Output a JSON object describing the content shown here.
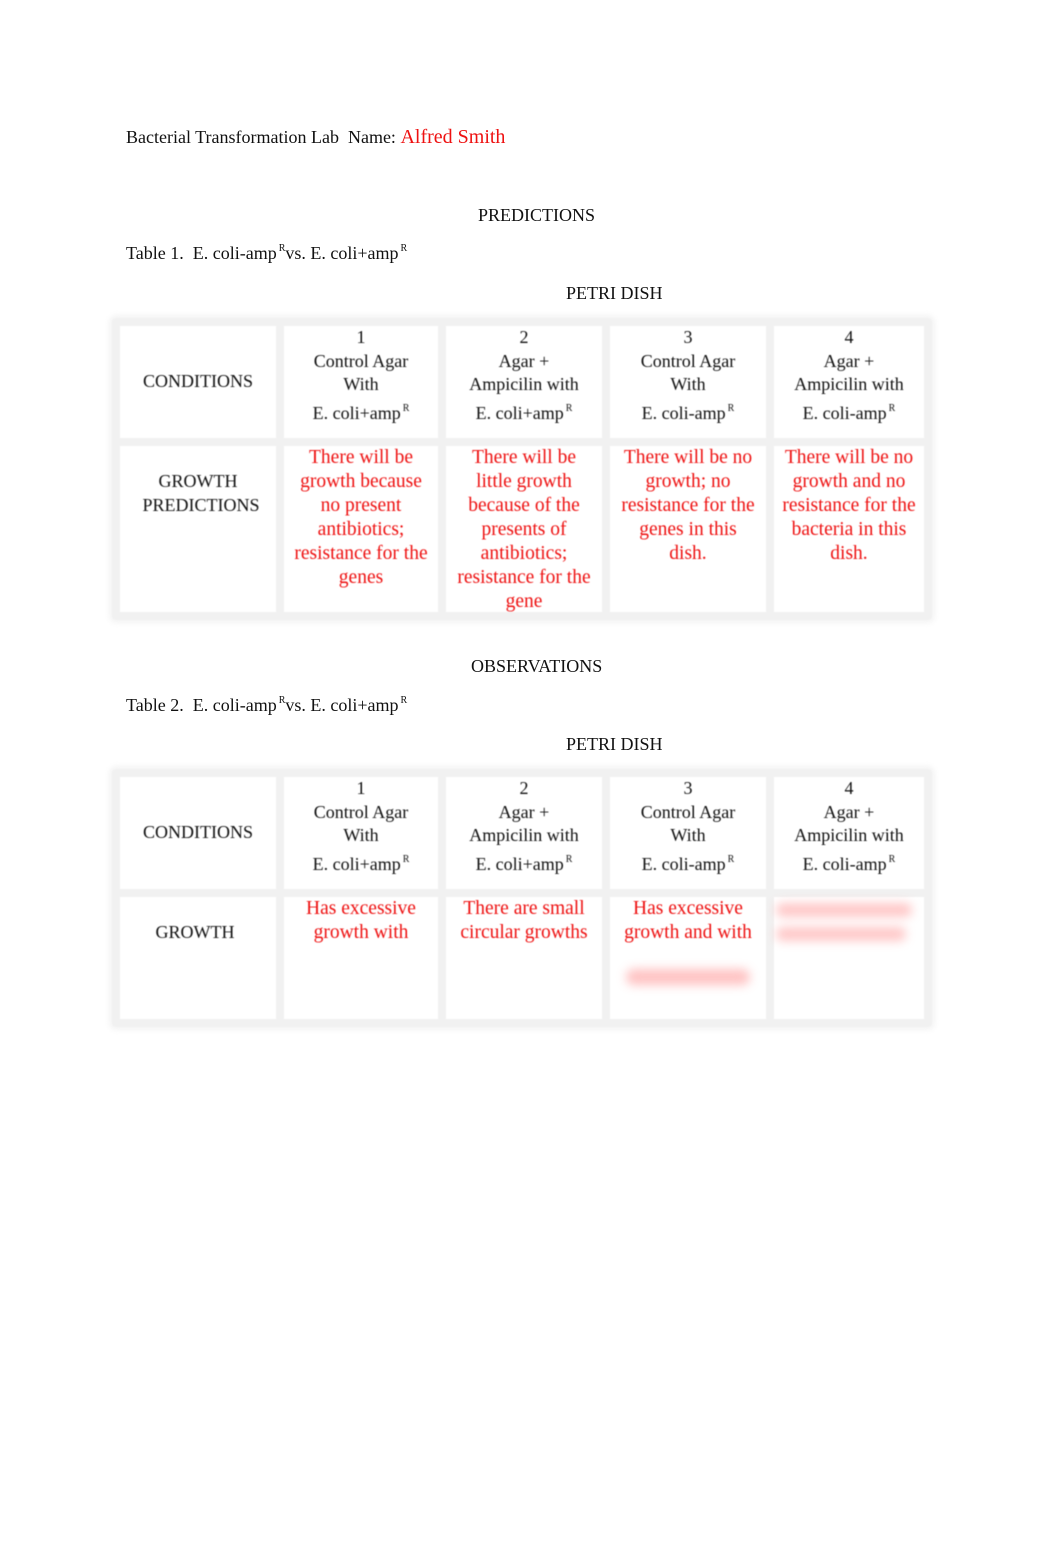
{
  "document": {
    "title_prefix": "Bacterial Transformation Lab  Name: ",
    "student_name": "Alfred Smith",
    "colors": {
      "text": "#111111",
      "answer": "#ee1111"
    }
  },
  "predictions": {
    "heading": "PREDICTIONS",
    "table_caption": {
      "prefix": "Table 1.  E. coli-amp",
      "sup1": "R",
      "middle": "vs. E. coli+amp",
      "sup2": "R"
    },
    "petri_heading": "PETRI DISH",
    "row_labels": {
      "conditions": "CONDITIONS",
      "growth": [
        "GROWTH",
        "PREDICTIONS"
      ]
    },
    "dishes": [
      {
        "number": "1",
        "lines": [
          "Control Agar",
          "With"
        ],
        "strain": "E. coli+amp",
        "sup": "R",
        "answer": [
          "There will be",
          "growth because",
          "no present",
          "antibiotics;",
          "resistance for the",
          "genes"
        ]
      },
      {
        "number": "2",
        "lines": [
          "Agar +",
          "Ampicilin with"
        ],
        "strain": "E. coli+amp",
        "sup": "R",
        "answer": [
          "There will be",
          "little growth",
          "because of the",
          "presents of",
          "antibiotics;",
          "resistance for the",
          "gene"
        ]
      },
      {
        "number": "3",
        "lines": [
          "Control Agar",
          "With"
        ],
        "strain": "E. coli-amp",
        "sup": "R",
        "answer": [
          "There will be no",
          "growth; no",
          "resistance for the",
          "genes in this",
          "dish."
        ]
      },
      {
        "number": "4",
        "lines": [
          "Agar +",
          "Ampicilin with"
        ],
        "strain": "E. coli-amp",
        "sup": "R",
        "answer": [
          "There will be no",
          "growth and no",
          "resistance for the",
          "bacteria in this",
          "dish."
        ]
      }
    ]
  },
  "observations": {
    "heading": "OBSERVATIONS",
    "table_caption": {
      "prefix": "Table 2.  E. coli-amp",
      "sup1": "R",
      "middle": "vs. E. coli+amp",
      "sup2": "R"
    },
    "petri_heading": "PETRI DISH",
    "row_labels": {
      "conditions": "CONDITIONS",
      "growth": "GROWTH"
    },
    "dishes": [
      {
        "number": "1",
        "lines": [
          "Control Agar",
          "With"
        ],
        "strain": "E. coli+amp",
        "sup": "R",
        "answer": [
          "Has excessive",
          "growth with"
        ]
      },
      {
        "number": "2",
        "lines": [
          "Agar +",
          "Ampicilin with"
        ],
        "strain": "E. coli+amp",
        "sup": "R",
        "answer": [
          "There are small",
          "circular growths"
        ]
      },
      {
        "number": "3",
        "lines": [
          "Control Agar",
          "With"
        ],
        "strain": "E. coli-amp",
        "sup": "R",
        "answer": [
          "Has excessive",
          "growth and with"
        ]
      },
      {
        "number": "4",
        "lines": [
          "Agar +",
          "Ampicilin with"
        ],
        "strain": "E. coli-amp",
        "sup": "R",
        "answer": []
      }
    ]
  }
}
